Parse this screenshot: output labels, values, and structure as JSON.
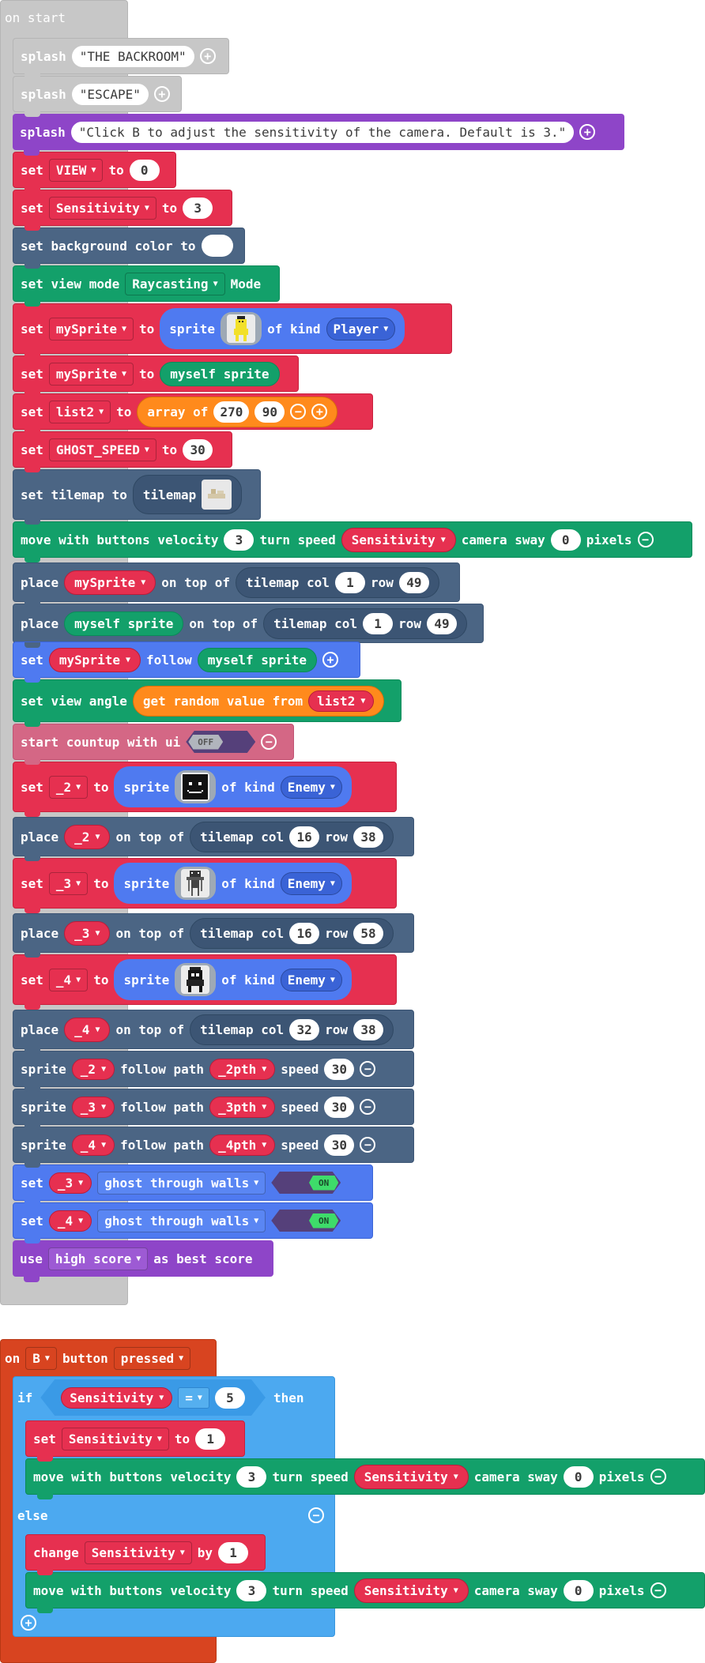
{
  "on_start": {
    "label": "on start",
    "splash1": {
      "kw": "splash",
      "text": "\"THE BACKROOM\""
    },
    "splash2": {
      "kw": "splash",
      "text": "\"ESCAPE\""
    },
    "splash3": {
      "kw": "splash",
      "text": "\"Click B to adjust the sensitivity of the camera. Default is 3.\""
    },
    "set_view": {
      "set": "set",
      "var": "VIEW",
      "to": "to",
      "val": "0"
    },
    "set_sens": {
      "set": "set",
      "var": "Sensitivity",
      "to": "to",
      "val": "3"
    },
    "bg": {
      "label": "set background color to"
    },
    "view_mode": {
      "label": "set view mode",
      "mode": "Raycasting",
      "suffix": "Mode"
    },
    "set_mysprite": {
      "set": "set",
      "var": "mySprite",
      "to": "to",
      "sprite": "sprite",
      "of_kind": "of kind",
      "kind": "Player"
    },
    "set_mysprite2": {
      "set": "set",
      "var": "mySprite",
      "to": "to",
      "val": "myself sprite"
    },
    "set_list2": {
      "set": "set",
      "var": "list2",
      "to": "to",
      "array": "array of",
      "v1": "270",
      "v2": "90"
    },
    "set_ghost": {
      "set": "set",
      "var": "GHOST_SPEED",
      "to": "to",
      "val": "30"
    },
    "tilemap": {
      "label": "set tilemap to",
      "tm": "tilemap"
    },
    "move": {
      "a": "move with buttons velocity",
      "vel": "3",
      "b": "turn speed",
      "var": "Sensitivity",
      "c": "camera sway",
      "sway": "0",
      "d": "pixels"
    },
    "place1": {
      "a": "place",
      "var": "mySprite",
      "b": "on top of",
      "tm": "tilemap col",
      "col": "1",
      "row_l": "row",
      "row": "49"
    },
    "place2": {
      "a": "place",
      "var": "myself sprite",
      "b": "on top of",
      "tm": "tilemap col",
      "col": "1",
      "row_l": "row",
      "row": "49"
    },
    "follow": {
      "a": "set",
      "var": "mySprite",
      "b": "follow",
      "val": "myself sprite"
    },
    "angle": {
      "a": "set view angle",
      "b": "get random value from",
      "var": "list2"
    },
    "countup": {
      "a": "start countup with ui",
      "toggle": "OFF"
    },
    "set2": {
      "set": "set",
      "var": "_2",
      "to": "to",
      "sprite": "sprite",
      "of_kind": "of kind",
      "kind": "Enemy"
    },
    "place_2": {
      "a": "place",
      "var": "_2",
      "b": "on top of",
      "tm": "tilemap col",
      "col": "16",
      "row_l": "row",
      "row": "38"
    },
    "set3": {
      "set": "set",
      "var": "_3",
      "to": "to",
      "sprite": "sprite",
      "of_kind": "of kind",
      "kind": "Enemy"
    },
    "place_3": {
      "a": "place",
      "var": "_3",
      "b": "on top of",
      "tm": "tilemap col",
      "col": "16",
      "row_l": "row",
      "row": "58"
    },
    "set4": {
      "set": "set",
      "var": "_4",
      "to": "to",
      "sprite": "sprite",
      "of_kind": "of kind",
      "kind": "Enemy"
    },
    "place_4": {
      "a": "place",
      "var": "_4",
      "b": "on top of",
      "tm": "tilemap col",
      "col": "32",
      "row_l": "row",
      "row": "38"
    },
    "path2": {
      "a": "sprite",
      "var": "_2",
      "b": "follow path",
      "path": "_2pth",
      "c": "speed",
      "speed": "30"
    },
    "path3": {
      "a": "sprite",
      "var": "_3",
      "b": "follow path",
      "path": "_3pth",
      "c": "speed",
      "speed": "30"
    },
    "path4": {
      "a": "sprite",
      "var": "_4",
      "b": "follow path",
      "path": "_4pth",
      "c": "speed",
      "speed": "30"
    },
    "ghost3": {
      "a": "set",
      "var": "_3",
      "prop": "ghost through walls",
      "toggle": "ON"
    },
    "ghost4": {
      "a": "set",
      "var": "_4",
      "prop": "ghost through walls",
      "toggle": "ON"
    },
    "score": {
      "a": "use",
      "dd": "high score",
      "b": "as best score"
    }
  },
  "on_b": {
    "on": "on",
    "btn": "B",
    "button": "button",
    "event": "pressed",
    "if_kw": "if",
    "cond_var": "Sensitivity",
    "op": "=",
    "cond_val": "5",
    "then": "then",
    "set1": {
      "set": "set",
      "var": "Sensitivity",
      "to": "to",
      "val": "1"
    },
    "move1": {
      "a": "move with buttons velocity",
      "vel": "3",
      "b": "turn speed",
      "var": "Sensitivity",
      "c": "camera sway",
      "sway": "0",
      "d": "pixels"
    },
    "else_kw": "else",
    "change": {
      "a": "change",
      "var": "Sensitivity",
      "b": "by",
      "val": "1"
    },
    "move2": {
      "a": "move with buttons velocity",
      "vel": "3",
      "b": "turn speed",
      "var": "Sensitivity",
      "c": "camera sway",
      "sway": "0",
      "d": "pixels"
    }
  },
  "icons": {
    "plus": "plus-circle-icon",
    "minus": "minus-circle-icon",
    "caret": "caret-down-icon"
  },
  "colors": {
    "event_hat": "#c7c7c7",
    "looks_purple": "#8e45c8",
    "var_red": "#e63050",
    "scene_slate": "#4b6584",
    "controller_green": "#13a06a",
    "sprite_blue": "#4f7af0",
    "logic_blue": "#4ca9f0",
    "orange_hat": "#d84420"
  }
}
